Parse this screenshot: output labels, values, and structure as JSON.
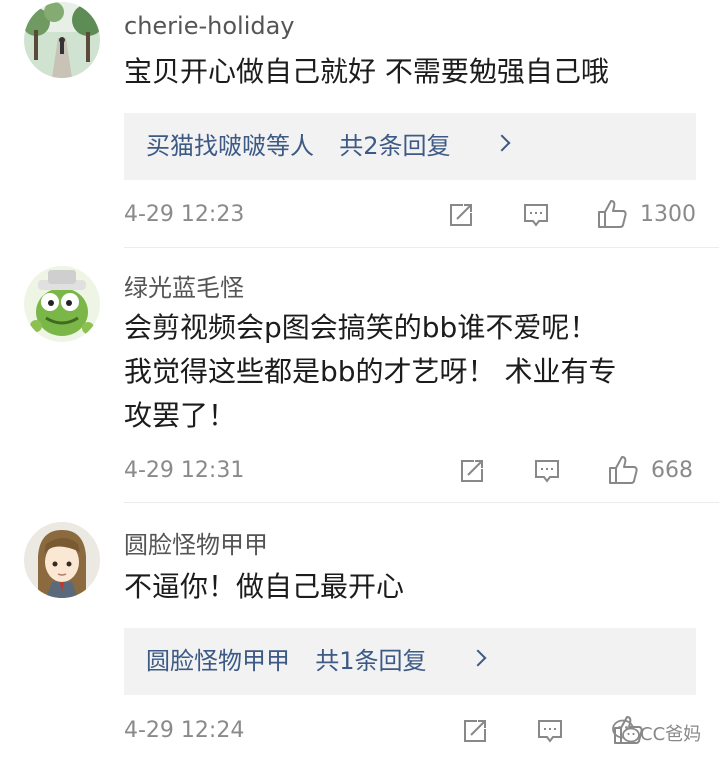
{
  "comments": [
    {
      "username": "cherie-holiday",
      "text": "宝贝开心做自己就好 不需要勉强自己哦",
      "reply_link": "买猫找啵啵等人",
      "reply_count": "共2条回复",
      "time": "4-29 12:23",
      "likes": "1300",
      "avatar": "outdoor-path-photo"
    },
    {
      "username": "绿光蓝毛怪",
      "text_lines": [
        "会剪视频会p图会搞笑的bb谁不爱呢！",
        "我觉得这些都是bb的才艺呀！ 术业有专",
        "攻罢了！"
      ],
      "time": "4-29 12:31",
      "likes": "668",
      "avatar": "green-monster-cartoon"
    },
    {
      "username": "圆脸怪物甲甲",
      "text": "不逼你！做自己最开心",
      "reply_link": "圆脸怪物甲甲",
      "reply_count": "共1条回复",
      "time": "4-29 12:24",
      "likes": "",
      "avatar": "anime-character-cartoon"
    }
  ],
  "icons": {
    "share": "share-icon",
    "comment": "comment-icon",
    "like": "thumbs-up-icon",
    "reply_arrow": "chevron-right-icon"
  },
  "colors": {
    "link": "#3d5a86",
    "meta": "#8a8a8a",
    "reply_bg": "#f2f2f2"
  },
  "watermark": {
    "text": "CC爸妈",
    "icon": "wechat-icon"
  }
}
